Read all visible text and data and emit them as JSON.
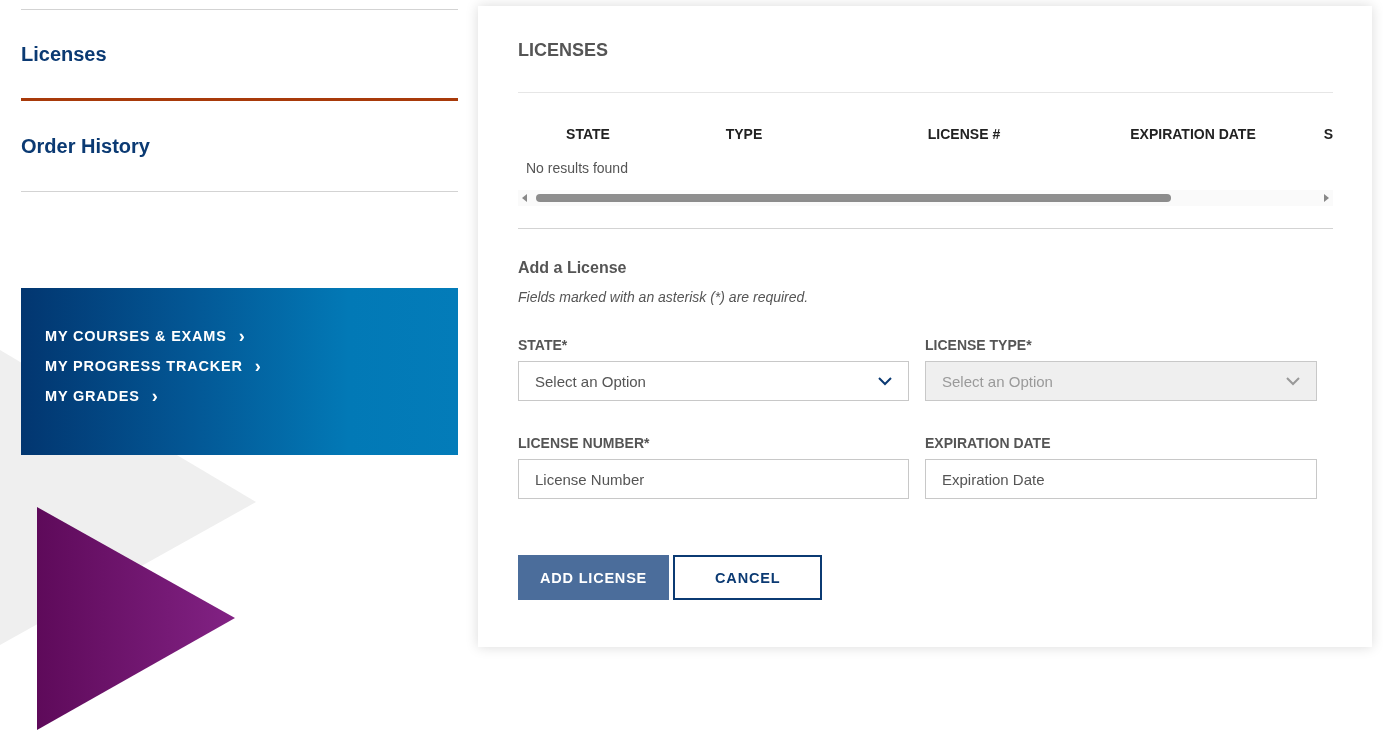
{
  "sidebar": {
    "items": [
      {
        "label": "Licenses",
        "selected": true
      },
      {
        "label": "Order History",
        "selected": false
      }
    ]
  },
  "quick_links": [
    {
      "label": "MY COURSES & EXAMS",
      "arrow": "›"
    },
    {
      "label": "MY PROGRESS TRACKER",
      "arrow": "›"
    },
    {
      "label": "MY GRADES",
      "arrow": "›"
    }
  ],
  "card": {
    "title": "LICENSES",
    "table": {
      "columns": [
        "STATE",
        "TYPE",
        "LICENSE #",
        "EXPIRATION DATE",
        "S"
      ],
      "empty_message": "No results found"
    },
    "form": {
      "title": "Add a License",
      "note": "Fields marked with an asterisk (*) are required.",
      "fields": [
        {
          "kind": "select",
          "label": "STATE*",
          "placeholder": "Select an Option",
          "disabled": false
        },
        {
          "kind": "select",
          "label": "LICENSE TYPE*",
          "placeholder": "Select an Option",
          "disabled": true
        },
        {
          "kind": "text",
          "label": "LICENSE NUMBER*",
          "placeholder": "License Number",
          "disabled": false
        },
        {
          "kind": "text",
          "label": "EXPIRATION DATE",
          "placeholder": "Expiration Date",
          "disabled": false
        }
      ],
      "buttons": [
        {
          "kind": "primary",
          "label": "ADD LICENSE"
        },
        {
          "kind": "secondary",
          "label": "CANCEL"
        }
      ]
    }
  }
}
